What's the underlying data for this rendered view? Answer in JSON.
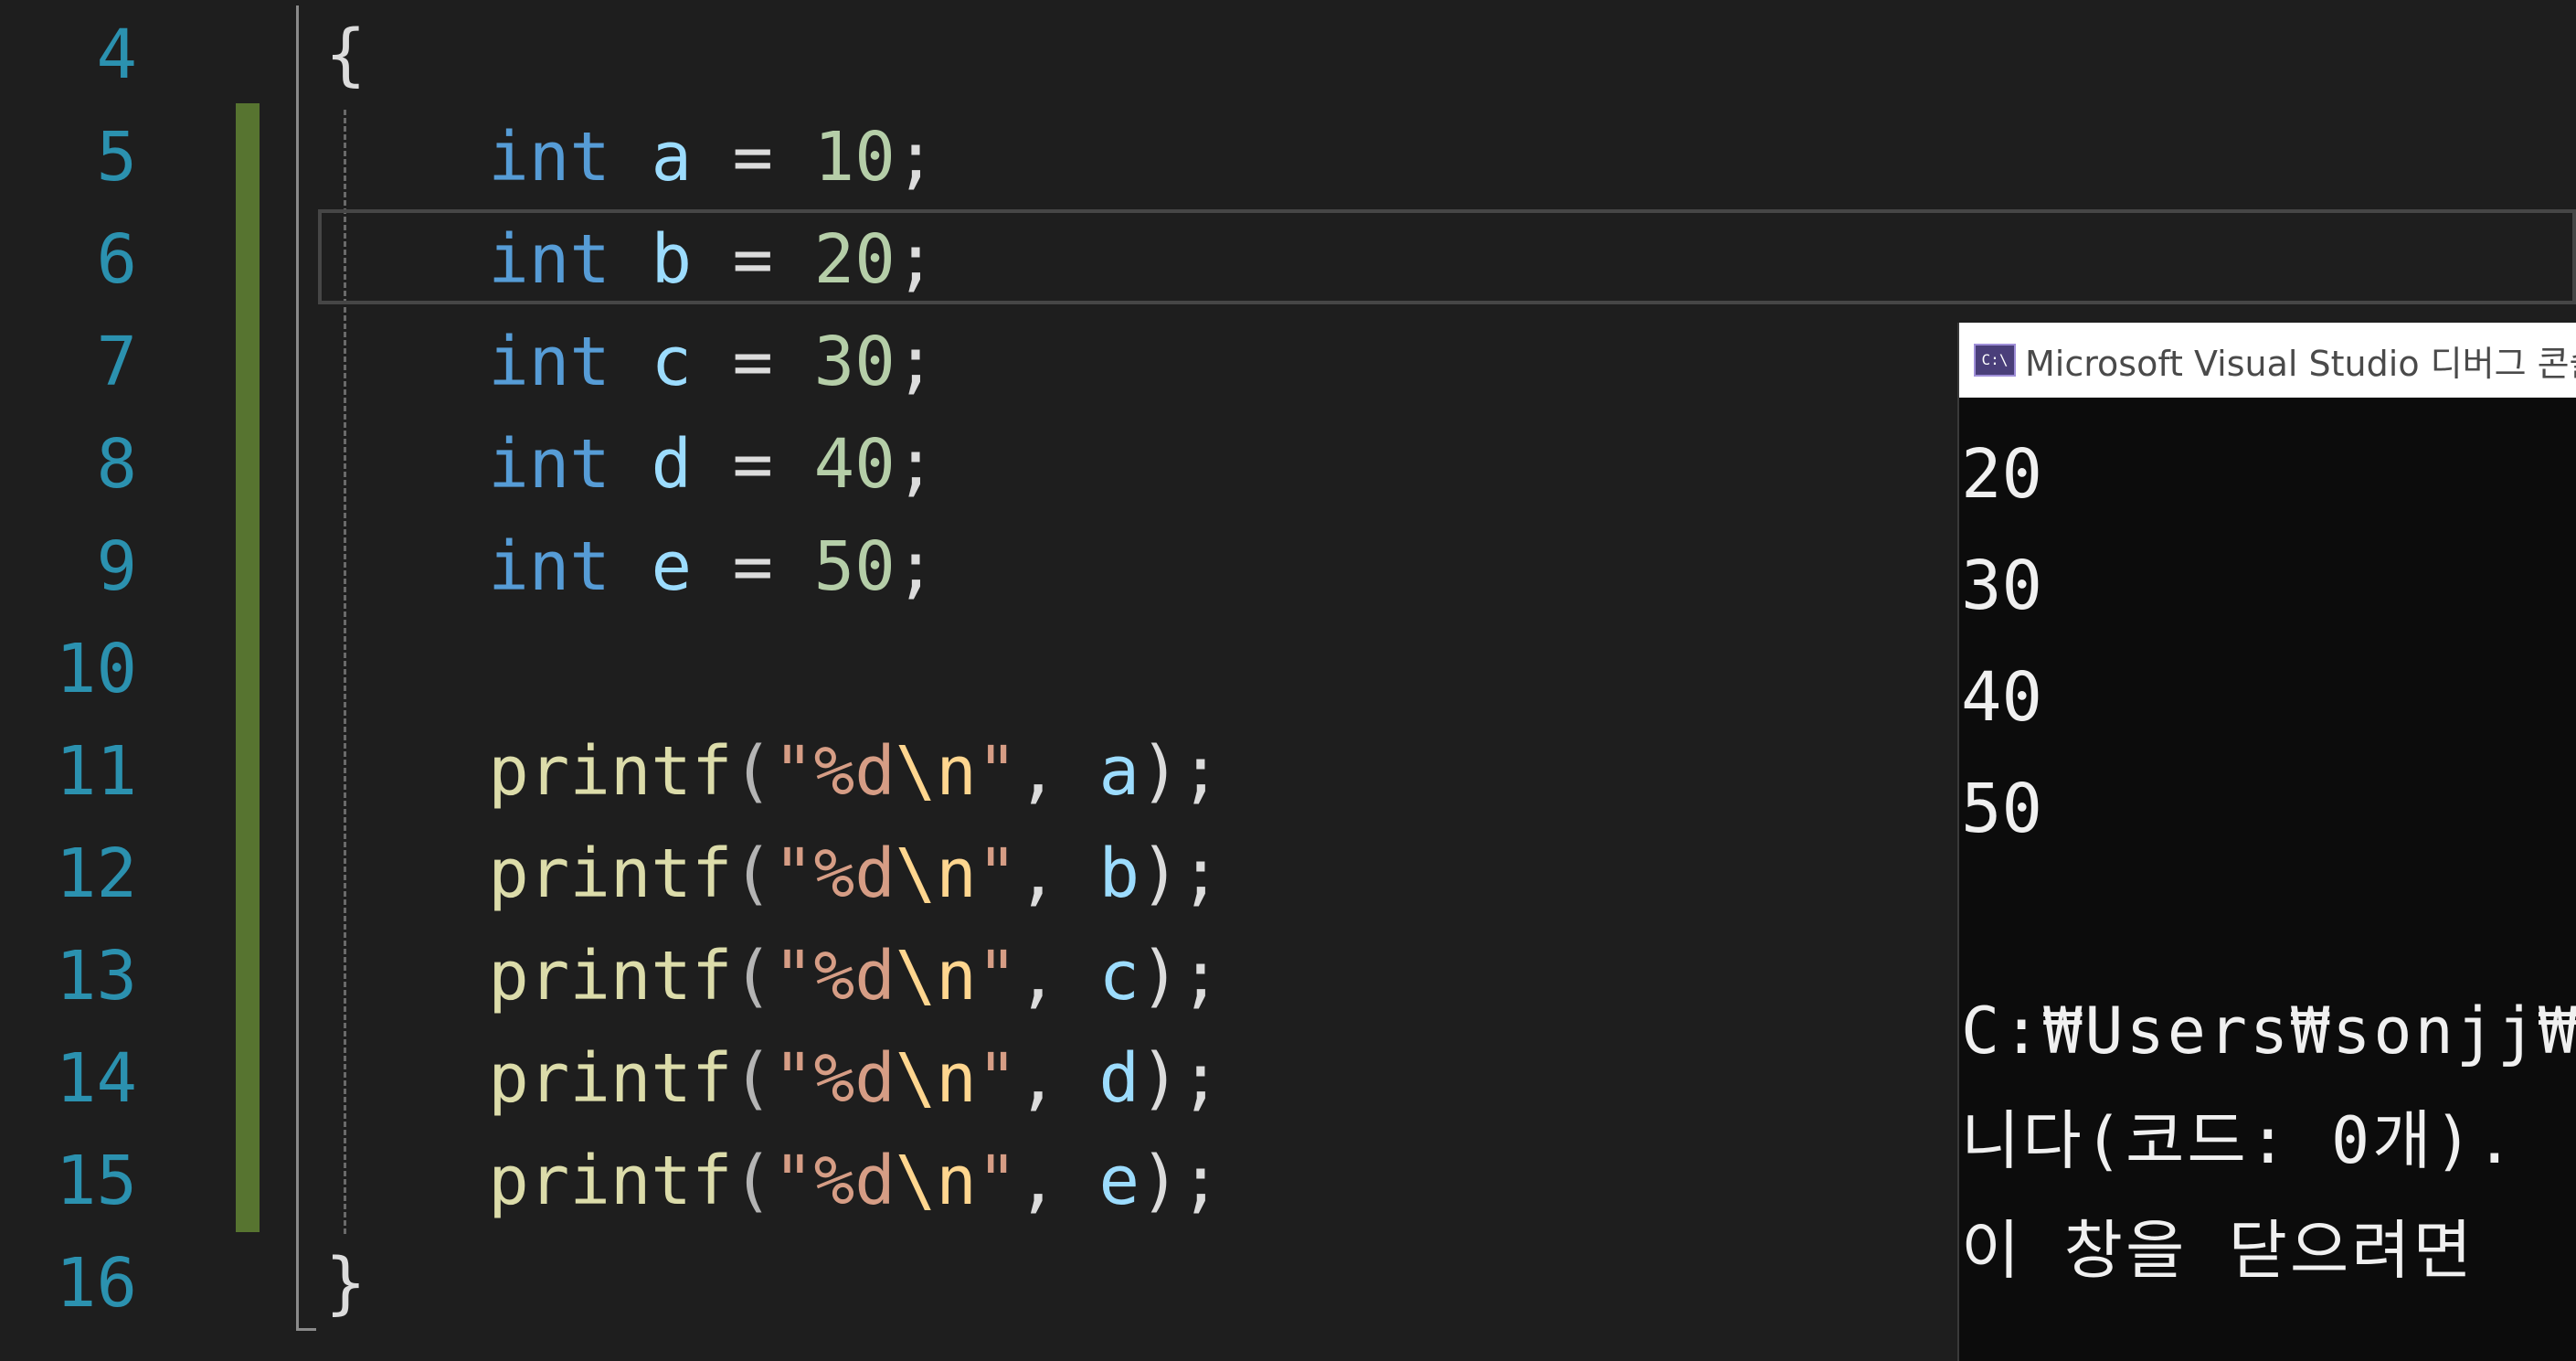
{
  "editor": {
    "lines": [
      {
        "number": "4",
        "tokens": [
          {
            "text": "{",
            "cls": "punc"
          }
        ]
      },
      {
        "number": "5",
        "tokens": [
          {
            "text": "    ",
            "cls": "punc"
          },
          {
            "text": "int",
            "cls": "kw"
          },
          {
            "text": " ",
            "cls": "punc"
          },
          {
            "text": "a",
            "cls": "var"
          },
          {
            "text": " = ",
            "cls": "punc"
          },
          {
            "text": "10",
            "cls": "num"
          },
          {
            "text": ";",
            "cls": "punc"
          }
        ]
      },
      {
        "number": "6",
        "tokens": [
          {
            "text": "    ",
            "cls": "punc"
          },
          {
            "text": "int",
            "cls": "kw"
          },
          {
            "text": " ",
            "cls": "punc"
          },
          {
            "text": "b",
            "cls": "var"
          },
          {
            "text": " = ",
            "cls": "punc"
          },
          {
            "text": "20",
            "cls": "num"
          },
          {
            "text": ";",
            "cls": "punc"
          }
        ]
      },
      {
        "number": "7",
        "tokens": [
          {
            "text": "    ",
            "cls": "punc"
          },
          {
            "text": "int",
            "cls": "kw"
          },
          {
            "text": " ",
            "cls": "punc"
          },
          {
            "text": "c",
            "cls": "var"
          },
          {
            "text": " = ",
            "cls": "punc"
          },
          {
            "text": "30",
            "cls": "num"
          },
          {
            "text": ";",
            "cls": "punc"
          }
        ]
      },
      {
        "number": "8",
        "tokens": [
          {
            "text": "    ",
            "cls": "punc"
          },
          {
            "text": "int",
            "cls": "kw"
          },
          {
            "text": " ",
            "cls": "punc"
          },
          {
            "text": "d",
            "cls": "var"
          },
          {
            "text": " = ",
            "cls": "punc"
          },
          {
            "text": "40",
            "cls": "num"
          },
          {
            "text": ";",
            "cls": "punc"
          }
        ]
      },
      {
        "number": "9",
        "tokens": [
          {
            "text": "    ",
            "cls": "punc"
          },
          {
            "text": "int",
            "cls": "kw"
          },
          {
            "text": " ",
            "cls": "punc"
          },
          {
            "text": "e",
            "cls": "var"
          },
          {
            "text": " = ",
            "cls": "punc"
          },
          {
            "text": "50",
            "cls": "num"
          },
          {
            "text": ";",
            "cls": "punc"
          }
        ]
      },
      {
        "number": "10",
        "tokens": []
      },
      {
        "number": "11",
        "tokens": [
          {
            "text": "    ",
            "cls": "punc"
          },
          {
            "text": "printf",
            "cls": "fn"
          },
          {
            "text": "(",
            "cls": "paren"
          },
          {
            "text": "\"%d",
            "cls": "str"
          },
          {
            "text": "\\n",
            "cls": "esc"
          },
          {
            "text": "\"",
            "cls": "str"
          },
          {
            "text": ", ",
            "cls": "punc"
          },
          {
            "text": "a",
            "cls": "var"
          },
          {
            "text": ");",
            "cls": "punc"
          }
        ]
      },
      {
        "number": "12",
        "tokens": [
          {
            "text": "    ",
            "cls": "punc"
          },
          {
            "text": "printf",
            "cls": "fn"
          },
          {
            "text": "(",
            "cls": "paren"
          },
          {
            "text": "\"%d",
            "cls": "str"
          },
          {
            "text": "\\n",
            "cls": "esc"
          },
          {
            "text": "\"",
            "cls": "str"
          },
          {
            "text": ", ",
            "cls": "punc"
          },
          {
            "text": "b",
            "cls": "var"
          },
          {
            "text": ");",
            "cls": "punc"
          }
        ]
      },
      {
        "number": "13",
        "tokens": [
          {
            "text": "    ",
            "cls": "punc"
          },
          {
            "text": "printf",
            "cls": "fn"
          },
          {
            "text": "(",
            "cls": "paren"
          },
          {
            "text": "\"%d",
            "cls": "str"
          },
          {
            "text": "\\n",
            "cls": "esc"
          },
          {
            "text": "\"",
            "cls": "str"
          },
          {
            "text": ", ",
            "cls": "punc"
          },
          {
            "text": "c",
            "cls": "var"
          },
          {
            "text": ");",
            "cls": "punc"
          }
        ]
      },
      {
        "number": "14",
        "tokens": [
          {
            "text": "    ",
            "cls": "punc"
          },
          {
            "text": "printf",
            "cls": "fn"
          },
          {
            "text": "(",
            "cls": "paren"
          },
          {
            "text": "\"%d",
            "cls": "str"
          },
          {
            "text": "\\n",
            "cls": "esc"
          },
          {
            "text": "\"",
            "cls": "str"
          },
          {
            "text": ", ",
            "cls": "punc"
          },
          {
            "text": "d",
            "cls": "var"
          },
          {
            "text": ");",
            "cls": "punc"
          }
        ]
      },
      {
        "number": "15",
        "tokens": [
          {
            "text": "    ",
            "cls": "punc"
          },
          {
            "text": "printf",
            "cls": "fn"
          },
          {
            "text": "(",
            "cls": "paren"
          },
          {
            "text": "\"%d",
            "cls": "str"
          },
          {
            "text": "\\n",
            "cls": "esc"
          },
          {
            "text": "\"",
            "cls": "str"
          },
          {
            "text": ", ",
            "cls": "punc"
          },
          {
            "text": "e",
            "cls": "var"
          },
          {
            "text": ");",
            "cls": "punc"
          }
        ]
      },
      {
        "number": "16",
        "tokens": [
          {
            "text": "}",
            "cls": "punc"
          }
        ]
      }
    ]
  },
  "console": {
    "title": "Microsoft Visual Studio 디버그 콘솔",
    "icon": "console-app-icon",
    "icon_glyph": "C:\\",
    "output_numbers": [
      "20",
      "30",
      "40",
      "50"
    ],
    "message_lines": [
      "C:₩Users₩sonjj₩sou",
      "니다(코드: 0개).",
      "이 창을 닫으려면"
    ]
  },
  "colors": {
    "background": "#1e1e1e",
    "line_number": "#2b91af",
    "keyword": "#569cd6",
    "variable": "#9cdcfe",
    "number": "#b5cea8",
    "function": "#dcdcaa",
    "string": "#d69d85",
    "escape": "#ffd68f",
    "change_bar": "#577430",
    "console_background": "#0c0c0c"
  }
}
